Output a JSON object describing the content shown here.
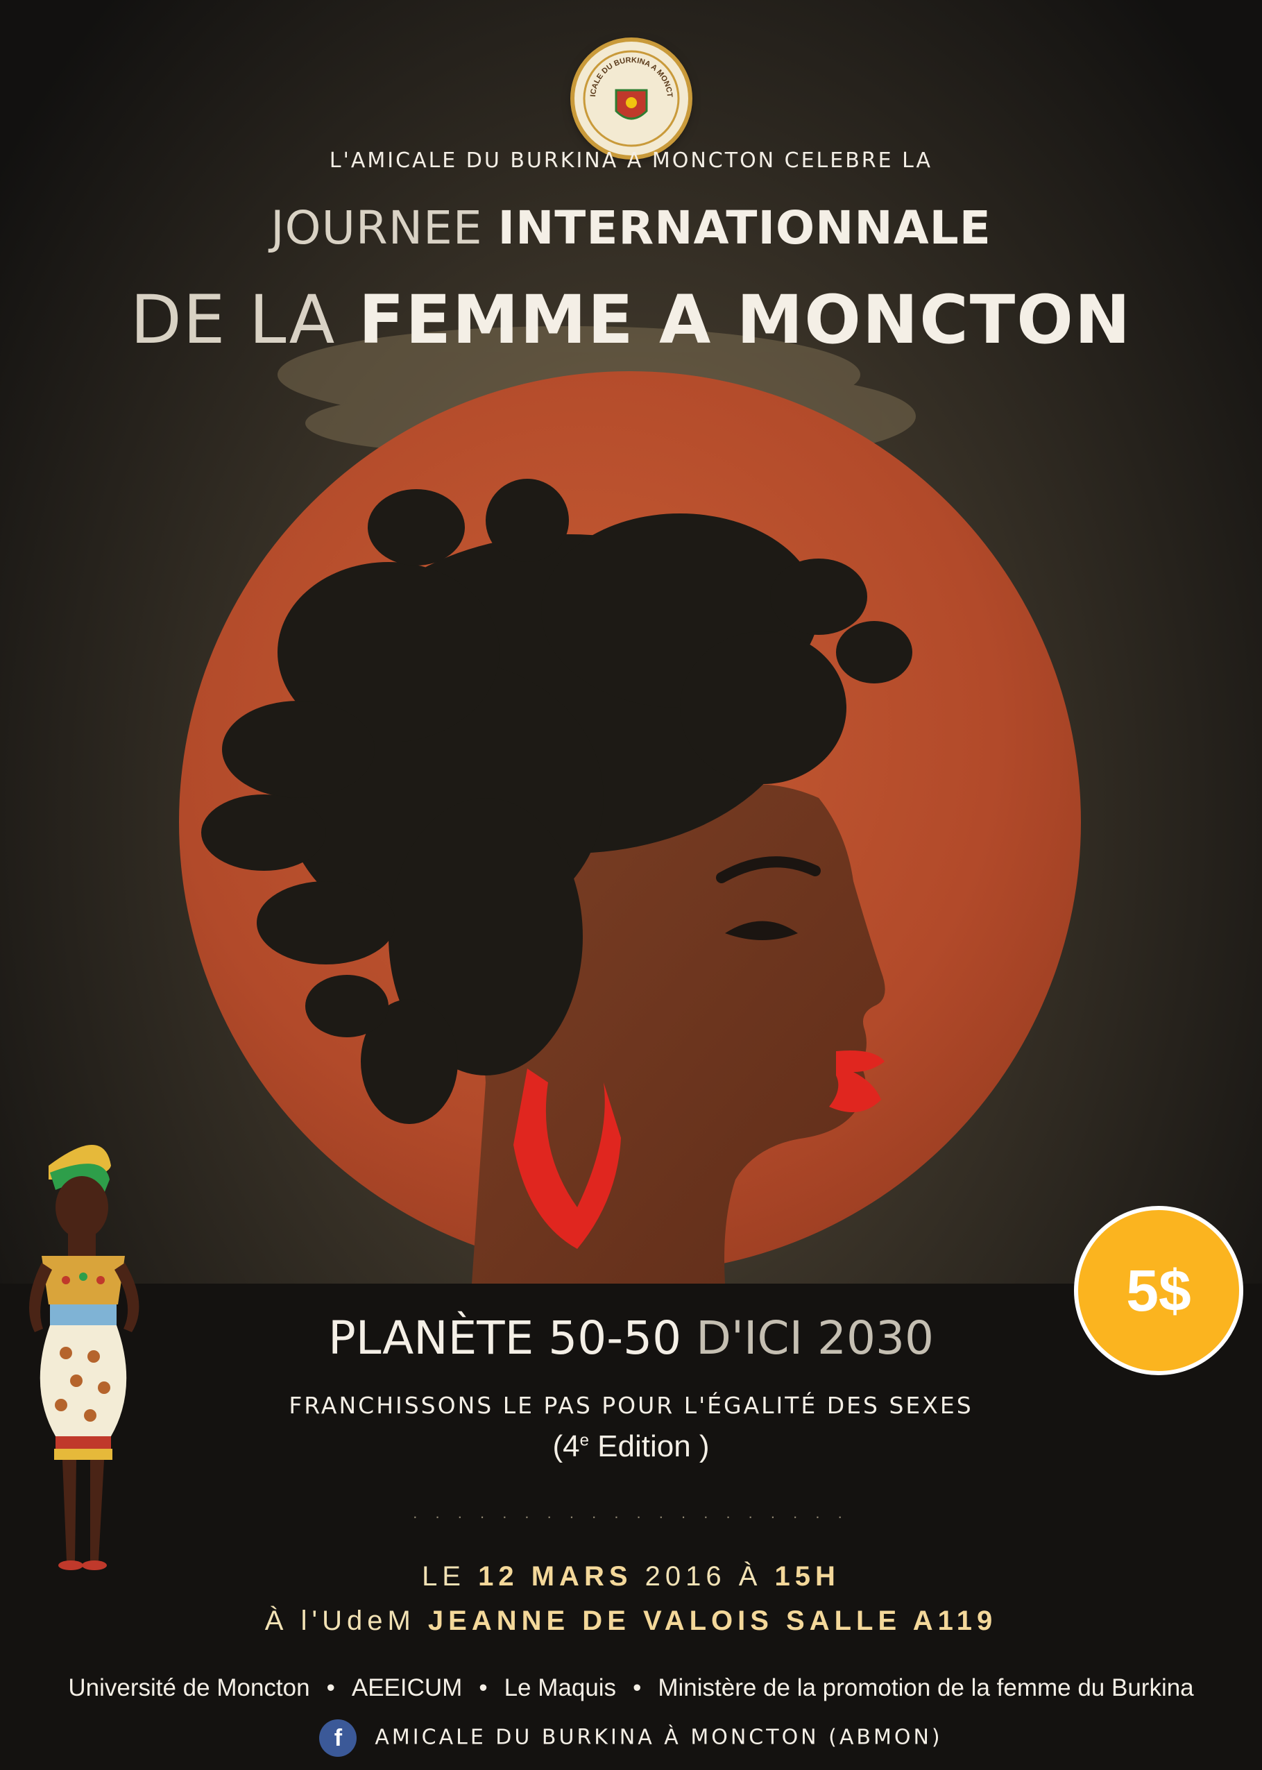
{
  "header": {
    "logo_text": "AMICALE DU BURKINA A MONCTON",
    "kicker": "L'AMICALE DU BURKINA A MONCTON CELEBRE LA",
    "title_line1_thin": "JOURNEE",
    "title_line1_bold": "INTERNATIONNALE",
    "title_line2_thin": "DE LA",
    "title_line2_bold": "FEMME A MONCTON"
  },
  "theme": {
    "main": "PLANÈTE 50-50",
    "thin": "D'ICI 2030",
    "subtitle": "FRANCHISSONS LE PAS POUR L'ÉGALITÉ DES SEXES",
    "edition_prefix": "(4",
    "edition_sup": "e",
    "edition_suffix": " Edition )"
  },
  "separator": ". . . . . . . . . . . . . . . . . . . .",
  "event": {
    "date_prefix": "LE",
    "date_day": "12 MARS",
    "date_year": "2016 À",
    "date_time": "15H",
    "venue_prefix": "À l'UdeM",
    "venue_name": "JEANNE DE VALOIS SALLE A119"
  },
  "price": "5$",
  "partners": [
    "Université de Moncton",
    "AEEICUM",
    "Le Maquis",
    "Ministère de la promotion de la femme du Burkina"
  ],
  "partner_separator": "•",
  "footer": {
    "facebook_icon_glyph": "f",
    "facebook_icon": "facebook-icon",
    "facebook_page": "AMICALE DU BURKINA À MONCTON (ABMON)"
  },
  "colors": {
    "background": "#151310",
    "sun": "#b84e2c",
    "accent_gold": "#f4d89a",
    "price_badge": "#fbb41f",
    "lips_earring": "#e0261f"
  }
}
